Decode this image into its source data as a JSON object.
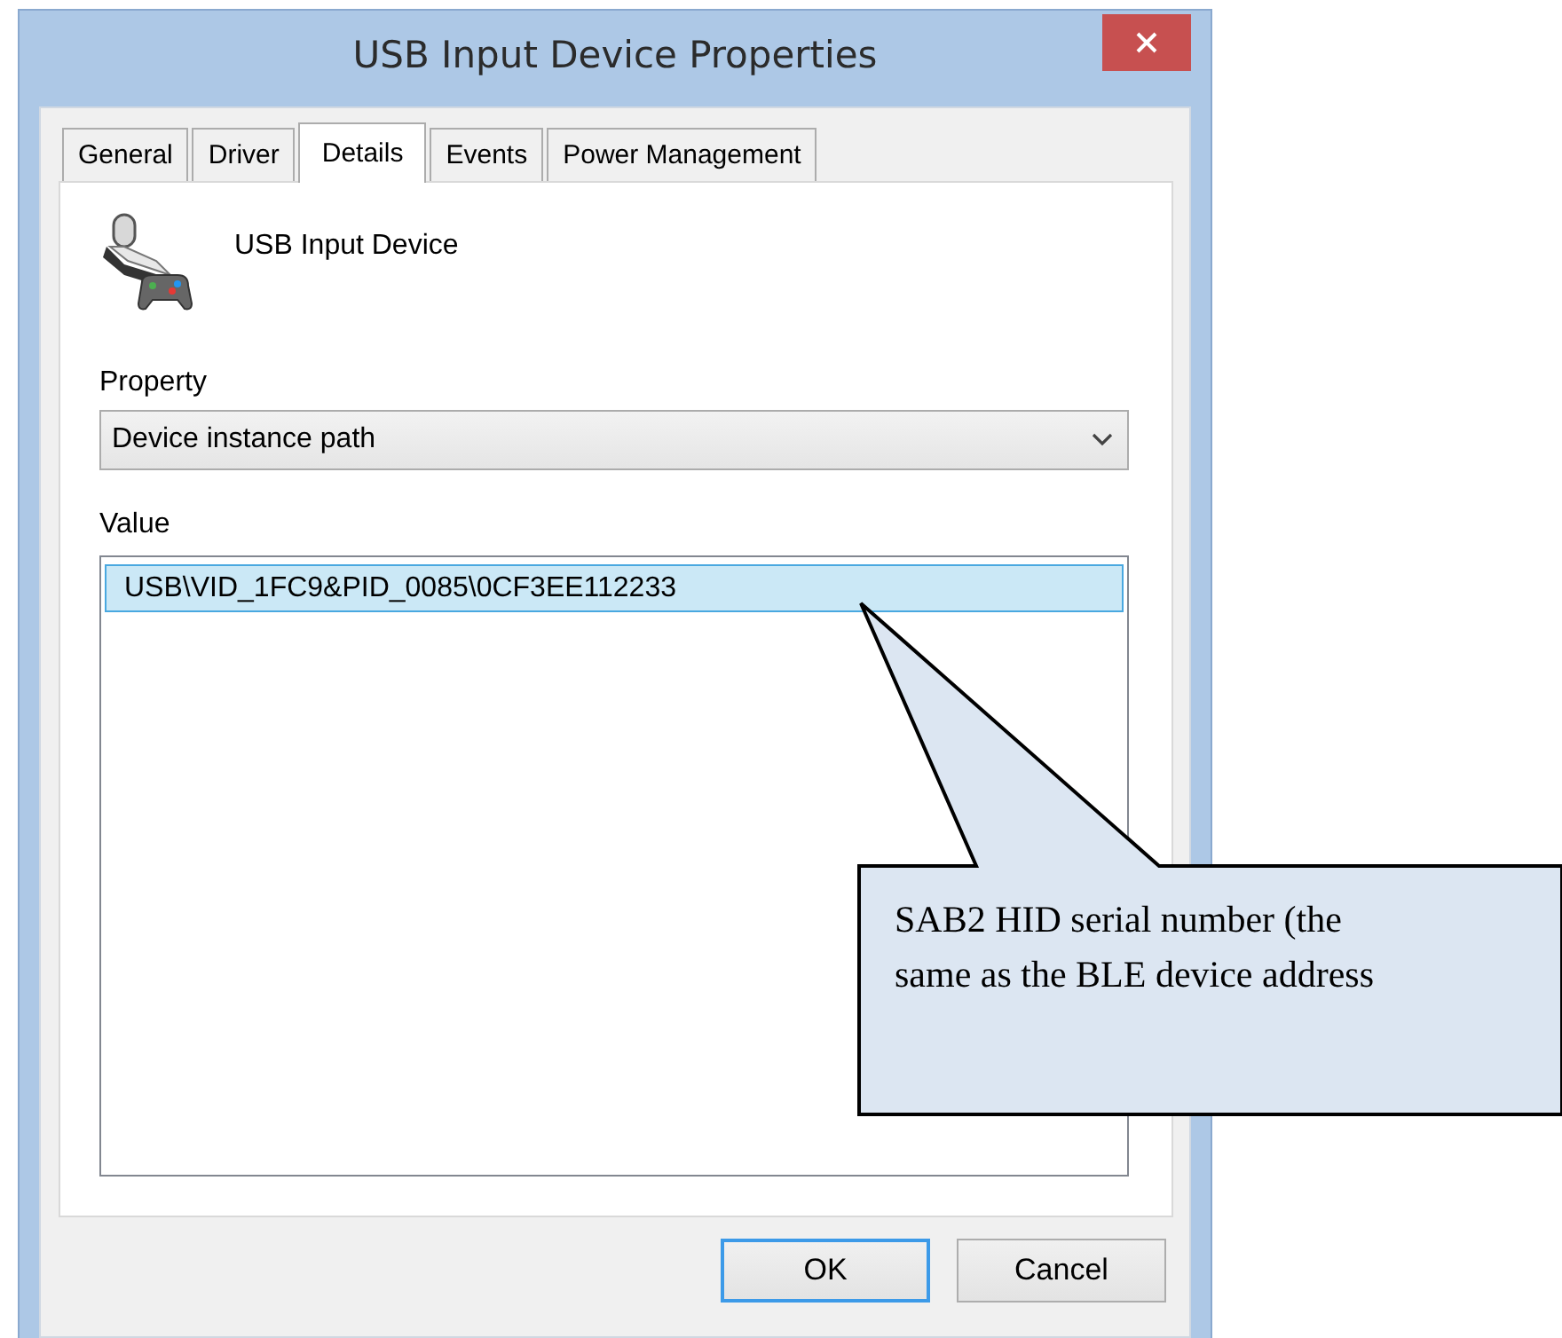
{
  "window": {
    "title": "USB Input Device Properties"
  },
  "tabs": [
    {
      "label": "General",
      "selected": false
    },
    {
      "label": "Driver",
      "selected": false
    },
    {
      "label": "Details",
      "selected": true
    },
    {
      "label": "Events",
      "selected": false
    },
    {
      "label": "Power Management",
      "selected": false
    }
  ],
  "device": {
    "name": "USB Input Device"
  },
  "property": {
    "label": "Property",
    "value": "Device instance path"
  },
  "value_list": {
    "label": "Value",
    "items": [
      {
        "text": "USB\\VID_1FC9&PID_0085\\0CF3EE112233",
        "selected": true
      }
    ]
  },
  "buttons": [
    {
      "label": "OK",
      "default": true
    },
    {
      "label": "Cancel",
      "default": false
    }
  ],
  "callout": {
    "text": "SAB2 HID serial number (the\nsame as the BLE device address"
  }
}
